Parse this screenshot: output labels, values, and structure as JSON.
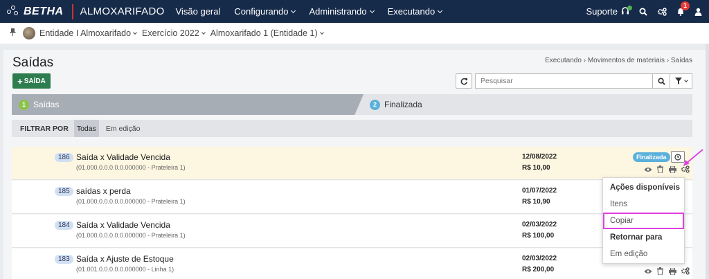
{
  "topbar": {
    "brand": "BETHA",
    "app_name": "ALMOXARIFADO",
    "nav": [
      "Visão geral",
      "Configurando",
      "Administrando",
      "Executando"
    ],
    "support": "Suporte",
    "notification_count": "1"
  },
  "context": {
    "entity": "Entidade I Almoxarifado",
    "exercise": "Exercício 2022",
    "warehouse": "Almoxarifado 1 (Entidade 1)"
  },
  "page": {
    "title": "Saídas",
    "breadcrumb": "Executando › Movimentos de materiais › Saídas",
    "add_button": "SAÍDA",
    "search_placeholder": "Pesquisar"
  },
  "steps": [
    {
      "num": "1",
      "label": "Saídas",
      "color": "#8bc34a"
    },
    {
      "num": "2",
      "label": "Finalizada",
      "color": "#5bb0dc"
    }
  ],
  "filter": {
    "label": "FILTRAR POR",
    "options": [
      "Todas",
      "Em edição"
    ]
  },
  "rows": [
    {
      "id": "186",
      "title": "Saída x Validade Vencida",
      "sub": "(01.000.0.0.0.0.0.000000 - Prateleira 1)",
      "date": "12/08/2022",
      "value": "R$ 10,00",
      "status": "Finalizada"
    },
    {
      "id": "185",
      "title": "saídas x perda",
      "sub": "(01.000.0.0.0.0.0.000000 - Prateleira 1)",
      "date": "01/07/2022",
      "value": "R$ 10,90"
    },
    {
      "id": "184",
      "title": "Saída x Validade Vencida",
      "sub": "(01.000.0.0.0.0.0.000000 - Prateleira 1)",
      "date": "02/03/2022",
      "value": "R$ 100,00"
    },
    {
      "id": "183",
      "title": "Saída x Ajuste de Estoque",
      "sub": "(01.001.0.0.0.0.0.000000 - Linha 1)",
      "date": "02/03/2022",
      "value": "R$ 200,00"
    }
  ],
  "dropdown": {
    "header": "Ações disponíveis",
    "items": [
      "Itens",
      "Copiar"
    ],
    "section": "Retornar para",
    "section_items": [
      "Em edição"
    ]
  },
  "colors": {
    "topbar": "#162a4a",
    "accent_green": "#2e7d4f",
    "highlight_magenta": "#e040e0",
    "status_blue": "#5bb0dc"
  }
}
